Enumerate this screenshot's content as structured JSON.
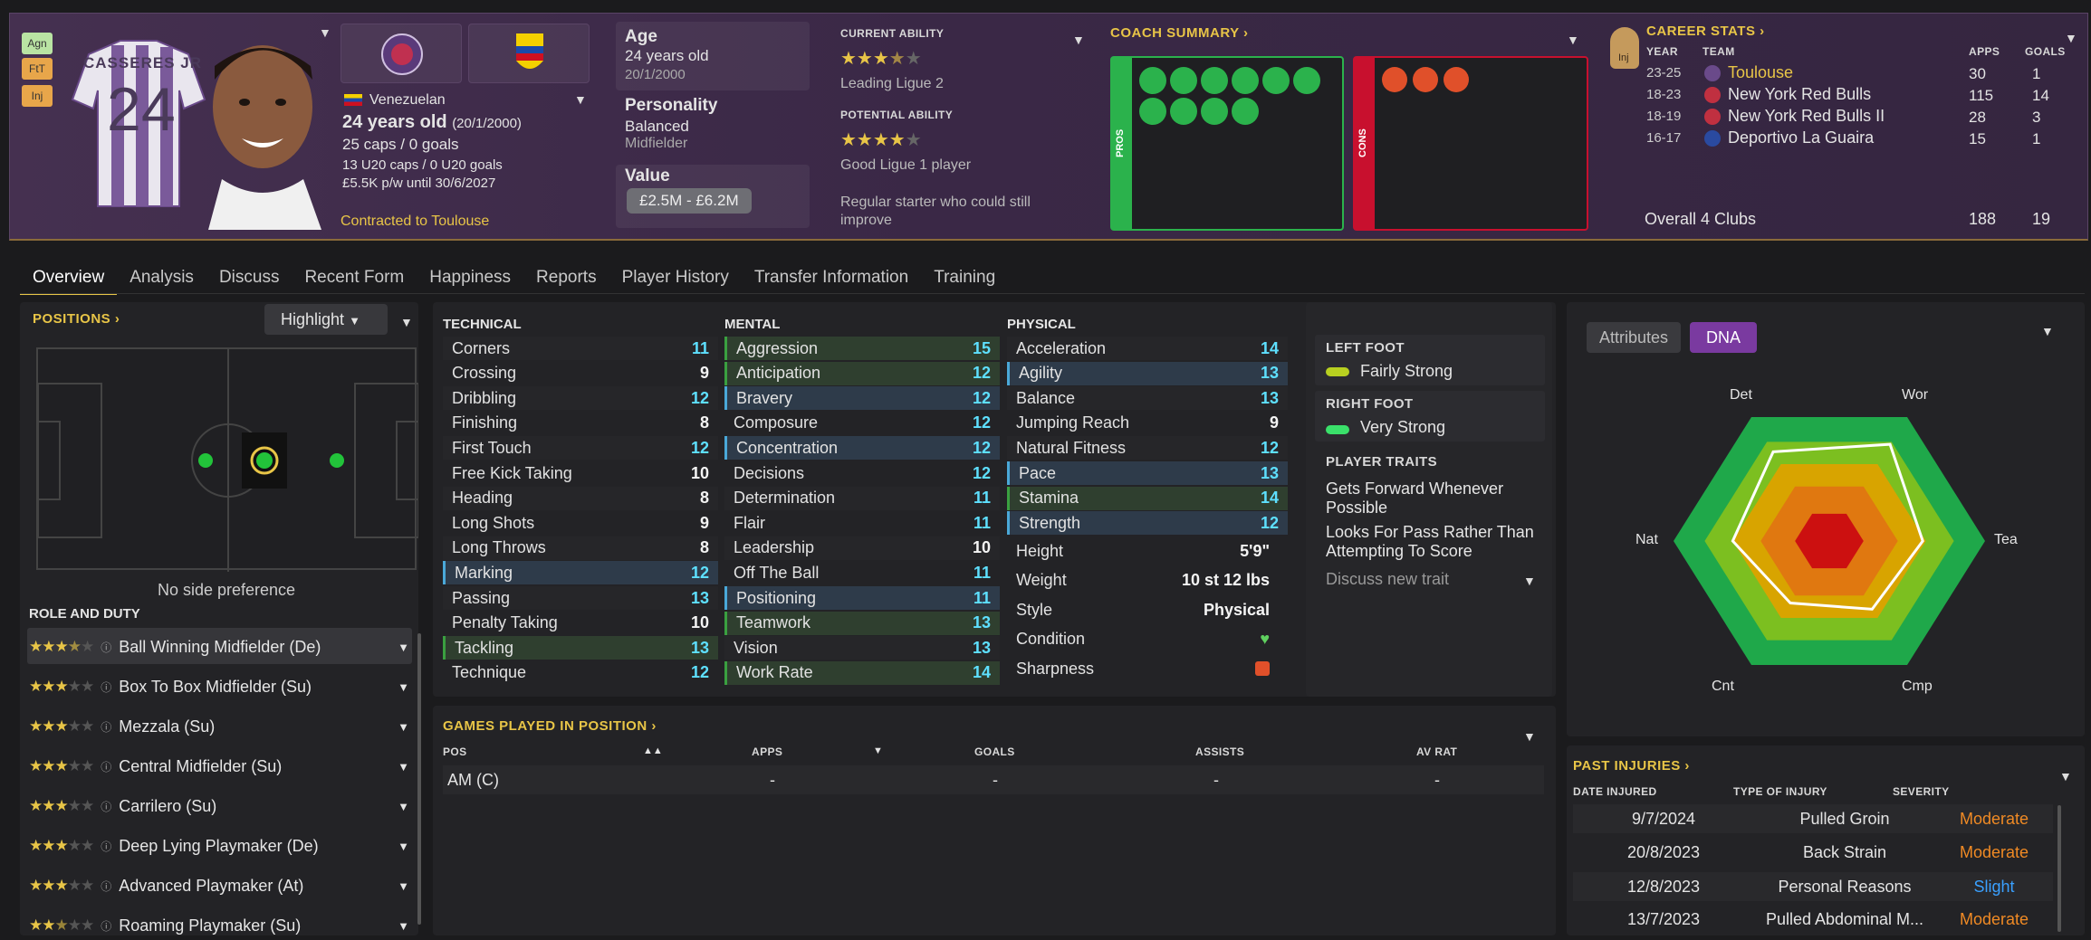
{
  "header": {
    "badges": [
      "Agn",
      "FtT",
      "Inj"
    ],
    "shirt_name": "CASSERES JR",
    "shirt_number": "24",
    "nationality": "Venezuelan",
    "age_line": "24 years old",
    "dob_paren": "(20/1/2000)",
    "caps": "25 caps / 0 goals",
    "u20_caps": "13 U20 caps / 0 U20 goals",
    "wage": "£5.5K p/w until 30/6/2027",
    "contracted": "Contracted to Toulouse",
    "age_label": "Age",
    "age_value": "24 years old",
    "dob": "20/1/2000",
    "personality_label": "Personality",
    "personality_value": "Balanced",
    "position_value": "Midfielder",
    "value_label": "Value",
    "value_range": "£2.5M - £6.2M",
    "current_ability_label": "CURRENT ABILITY",
    "current_ability_text": "Leading Ligue 2",
    "current_stars": 3.5,
    "potential_ability_label": "POTENTIAL ABILITY",
    "potential_ability_text": "Good Ligue 1 player",
    "potential_stars": 4,
    "ability_note": "Regular starter who could still improve",
    "coach_summary": "COACH SUMMARY",
    "pros": "PROS",
    "cons": "CONS",
    "career": {
      "title": "CAREER STATS",
      "cols": [
        "YEAR",
        "TEAM",
        "APPS",
        "GOALS"
      ],
      "rows": [
        {
          "year": "23-25",
          "team": "Toulouse",
          "apps": "30",
          "goals": "1"
        },
        {
          "year": "18-23",
          "team": "New York Red Bulls",
          "apps": "115",
          "goals": "14"
        },
        {
          "year": "18-19",
          "team": "New York Red Bulls II",
          "apps": "28",
          "goals": "3"
        },
        {
          "year": "16-17",
          "team": "Deportivo La Guaira",
          "apps": "15",
          "goals": "1"
        }
      ],
      "overall": "Overall 4 Clubs",
      "overall_apps": "188",
      "overall_goals": "19",
      "inj": "Inj"
    }
  },
  "tabs": [
    "Overview",
    "Analysis",
    "Discuss",
    "Recent Form",
    "Happiness",
    "Reports",
    "Player History",
    "Transfer Information",
    "Training"
  ],
  "positions": {
    "title": "POSITIONS",
    "highlight": "Highlight",
    "note": "No side preference"
  },
  "role_duty": {
    "title": "ROLE AND DUTY",
    "roles": [
      {
        "name": "Ball Winning Midfielder (De)",
        "stars": 3.5
      },
      {
        "name": "Box To Box Midfielder (Su)",
        "stars": 3
      },
      {
        "name": "Mezzala (Su)",
        "stars": 3
      },
      {
        "name": "Central Midfielder (Su)",
        "stars": 3
      },
      {
        "name": "Carrilero (Su)",
        "stars": 3
      },
      {
        "name": "Deep Lying Playmaker (De)",
        "stars": 3
      },
      {
        "name": "Advanced Playmaker (At)",
        "stars": 3
      },
      {
        "name": "Roaming Playmaker (Su)",
        "stars": 2.5
      }
    ]
  },
  "attributes": {
    "technical_title": "TECHNICAL",
    "mental_title": "MENTAL",
    "physical_title": "PHYSICAL",
    "technical": [
      [
        "Corners",
        "11",
        ""
      ],
      [
        "Crossing",
        "9",
        ""
      ],
      [
        "Dribbling",
        "12",
        ""
      ],
      [
        "Finishing",
        "8",
        ""
      ],
      [
        "First Touch",
        "12",
        ""
      ],
      [
        "Free Kick Taking",
        "10",
        ""
      ],
      [
        "Heading",
        "8",
        ""
      ],
      [
        "Long Shots",
        "9",
        ""
      ],
      [
        "Long Throws",
        "8",
        ""
      ],
      [
        "Marking",
        "12",
        "blue"
      ],
      [
        "Passing",
        "13",
        ""
      ],
      [
        "Penalty Taking",
        "10",
        ""
      ],
      [
        "Tackling",
        "13",
        "green"
      ],
      [
        "Technique",
        "12",
        ""
      ]
    ],
    "mental": [
      [
        "Aggression",
        "15",
        "green"
      ],
      [
        "Anticipation",
        "12",
        "green"
      ],
      [
        "Bravery",
        "12",
        "blue"
      ],
      [
        "Composure",
        "12",
        ""
      ],
      [
        "Concentration",
        "12",
        "blue"
      ],
      [
        "Decisions",
        "12",
        ""
      ],
      [
        "Determination",
        "11",
        ""
      ],
      [
        "Flair",
        "11",
        ""
      ],
      [
        "Leadership",
        "10",
        ""
      ],
      [
        "Off The Ball",
        "11",
        ""
      ],
      [
        "Positioning",
        "11",
        "blue"
      ],
      [
        "Teamwork",
        "13",
        "green"
      ],
      [
        "Vision",
        "13",
        ""
      ],
      [
        "Work Rate",
        "14",
        "green"
      ]
    ],
    "physical": [
      [
        "Acceleration",
        "14",
        ""
      ],
      [
        "Agility",
        "13",
        "blue"
      ],
      [
        "Balance",
        "13",
        ""
      ],
      [
        "Jumping Reach",
        "9",
        ""
      ],
      [
        "Natural Fitness",
        "12",
        ""
      ],
      [
        "Pace",
        "13",
        "blue"
      ],
      [
        "Stamina",
        "14",
        "green"
      ],
      [
        "Strength",
        "12",
        "blue"
      ]
    ],
    "height_label": "Height",
    "height": "5'9\"",
    "weight_label": "Weight",
    "weight": "10 st 12 lbs",
    "style_label": "Style",
    "style": "Physical",
    "condition_label": "Condition",
    "sharpness_label": "Sharpness"
  },
  "feet": {
    "left_label": "LEFT FOOT",
    "left": "Fairly Strong",
    "right_label": "RIGHT FOOT",
    "right": "Very Strong",
    "traits_label": "PLAYER TRAITS",
    "traits": [
      "Gets Forward Whenever Possible",
      "Looks For Pass Rather Than Attempting To Score"
    ],
    "discuss": "Discuss new trait"
  },
  "dna": {
    "tab_attributes": "Attributes",
    "tab_dna": "DNA",
    "labels": [
      "Det",
      "Wor",
      "Tea",
      "Cmp",
      "Cnt",
      "Nat"
    ],
    "values": [
      0.72,
      0.78,
      0.6,
      0.55,
      0.5,
      0.62
    ]
  },
  "games": {
    "title": "GAMES PLAYED IN POSITION",
    "cols": [
      "POS",
      "APPS",
      "GOALS",
      "ASSISTS",
      "AV RAT"
    ],
    "row": [
      "AM (C)",
      "-",
      "-",
      "-",
      "-"
    ]
  },
  "injuries": {
    "title": "PAST INJURIES",
    "cols": [
      "DATE INJURED",
      "TYPE OF INJURY",
      "SEVERITY"
    ],
    "rows": [
      {
        "date": "9/7/2024",
        "type": "Pulled Groin",
        "sev": "Moderate"
      },
      {
        "date": "20/8/2023",
        "type": "Back Strain",
        "sev": "Moderate"
      },
      {
        "date": "12/8/2023",
        "type": "Personal Reasons",
        "sev": "Slight"
      },
      {
        "date": "13/7/2023",
        "type": "Pulled Abdominal M...",
        "sev": "Moderate"
      }
    ]
  },
  "colors": {
    "accent": "#e8c547",
    "pros": "#2bb24c",
    "cons": "#c8102e",
    "stat": "#5ee0ff",
    "moderate": "#f08a24",
    "slight": "#3aa0ff"
  }
}
